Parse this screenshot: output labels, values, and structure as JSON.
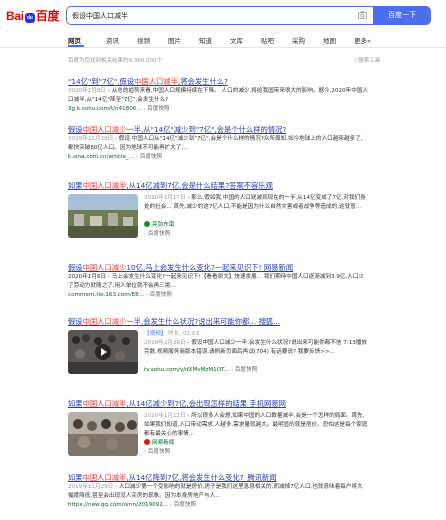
{
  "header": {
    "logo_bai": "Bai",
    "logo_paw": "du",
    "logo_cn": "百度",
    "query": "假设中国人口减半",
    "search_button": "百度一下"
  },
  "tabs": [
    "网页",
    "资讯",
    "视频",
    "图片",
    "知道",
    "文库",
    "贴吧",
    "采购",
    "地图",
    "更多»"
  ],
  "stats": "百度为您找到相关结果约9,360,000个",
  "tools": "▽搜索工具",
  "results": [
    {
      "title_parts": [
        "\"14亿\"到\"7亿\",假设",
        "中国人口减半",
        ",将会发生什么?"
      ],
      "abstract_date": "2020年1月8日",
      "abstract": " - 从总的趋势来看,中国人口规模持续在下降。 人口的减少,将给我国带来很大的影响。据今,2020年中国人口减半,从\"14亿\"降至\"7亿\",会发生什么?",
      "url": "3g.k.sohu.com/t/n41806...",
      "snapshot": "- 百度快照"
    },
    {
      "title_parts": [
        "假设",
        "中国人口减少",
        "一半,从\"14亿\"减少到\"7亿\",会是个什么样的情况?"
      ],
      "abstract_date": "2019年12月29日",
      "abstract": " - 假设,中国人口从\"14亿\"减少到\"7亿\",会是个什么样的情况?众所周知,如今地球上的人口越来越多了,都快突破80亿人口。因为地球不可能再扩大了,...",
      "url": "k.sina.com.cn/article_...",
      "snapshot": "- 百度快照"
    },
    {
      "title_parts": [
        "如果",
        "中国人口减半",
        ",从14亿减到7亿,会是什么结果?答案不容乐观"
      ],
      "abstract_date": "2020年1月17日",
      "abstract": " - 那么,假如我,中国的人口锐减到现在的一半,从14亿变成了7亿,对我们身处的社会... 首先,减少的这7亿人口,不能是因为什么自然灾害或者战争等造成的,这就意...",
      "source": "亮剑东南",
      "snapshot": "- 百度快照"
    },
    {
      "title_parts": [
        "假设",
        "中国人口减少",
        "10亿,马上会发生什么变化?一起来见识下! 网易新闻"
      ],
      "abstract": "2020年1月6日 - 马上会发生什么变化?一起来见识下!【看看原文】快速发展... 我们期待中国人口逐渐减到3.9亿,人口少了劳动力就随之了,用人单位就不会再三挑...",
      "url": "comment.tie.163.com/E8...",
      "snapshot": "- 百度快照"
    },
    {
      "title_parts": [
        "假设",
        "中国人口减少",
        "一半,会发生什么状况?说出来可能你都... 搜狐..."
      ],
      "video_label": "【视频】",
      "video_duration": "时长: 01:03",
      "abstract_date": "2019年2月26日",
      "abstract": " - 假设中国人口减少一半,会发生什么状况?说出来可能你都不信 7:13播放完数,视频服务商版本错误,请刷新页面后再试(704) 有话要说? 我要反馈>>...",
      "url": "tv.sohu.com/v/dXMvMzM1OT...",
      "snapshot": "- 百度快照"
    },
    {
      "title_parts": [
        "如果",
        "中国人口减半",
        ",从14亿减少到7亿,会出现怎样的结果 手机网易网"
      ],
      "abstract_date": "2020年1月12日",
      "abstract": " - 所以很多人会想,如果中国的人口数量减半,会是一个怎样的局面。首先,如果我们知道,人口带动需求,人越多,需求量就越大。最明显的就是房价。恐怕这是每个家庭都有最关心的事情...",
      "source": "网易新闻",
      "snapshot": "- 百度快照"
    },
    {
      "title_parts": [
        "如果",
        "中国人口减半",
        ",从14亿降到7亿,将会发生什么变化?_腾讯新闻"
      ],
      "abstract_date": "2019年11月29日",
      "abstract": " - 人口减少第一个受影响的就是房价,房子是我们这里息息相关的,而减掉7亿人口,也就意味着每户将大幅度降低,甚至会出现没人买房的现象。因为本身房地产与人...",
      "url": "https://new.qq.com/omn/2019092...",
      "snapshot": "- 百度快照"
    }
  ]
}
